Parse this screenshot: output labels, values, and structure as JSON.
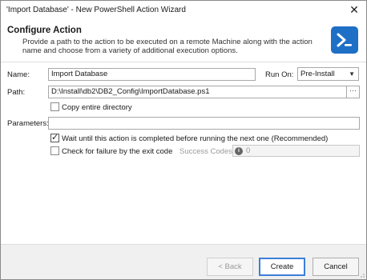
{
  "window": {
    "title": "'Import Database' - New PowerShell Action Wizard",
    "close_glyph": "✕"
  },
  "header": {
    "title": "Configure Action",
    "description": "Provide a path to the action to be executed on a remote Machine along with the action name and choose from a variety of additional execution options.",
    "logo_icon": "powershell-icon",
    "logo_color": "#1e6fc6"
  },
  "form": {
    "name_label": "Name:",
    "name_value": "Import Database",
    "run_on_label": "Run On:",
    "run_on_value": "Pre-Install",
    "path_label": "Path:",
    "path_value": "D:\\Install\\db2\\DB2_Config\\ImportDatabase.ps1",
    "browse_glyph": "···",
    "copy_dir_label": "Copy entire directory",
    "copy_dir_checked": false,
    "parameters_label": "Parameters:",
    "parameters_value": "",
    "wait_label": "Wait until this action is completed before running the next one (Recommended)",
    "wait_checked": true,
    "check_failure_label": "Check for failure by the exit code",
    "check_failure_checked": false,
    "success_codes_label": "Success Codes:",
    "success_codes_value": "0"
  },
  "footer": {
    "back_label": "< Back",
    "create_label": "Create",
    "cancel_label": "Cancel"
  }
}
